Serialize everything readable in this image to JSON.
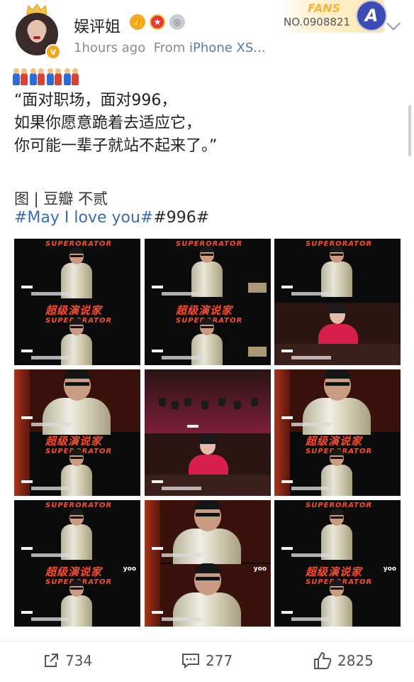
{
  "header": {
    "username": "娱评姐",
    "timestamp": "1hours ago",
    "source_prefix": "From",
    "source_device": "iPhone XS...",
    "fans_card": {
      "label": "FANS",
      "number": "NO.0908821",
      "logo_letter": "A"
    },
    "verified_mark": "V"
  },
  "post": {
    "emoji": [
      "couple-emoji",
      "couple-emoji",
      "couple-emoji",
      "couple-emoji"
    ],
    "text": "“面对职场，面对996，\n如果你愿意跪着去适应它，\n你可能一辈子就站不起来了。”",
    "credit": "图 | 豆瓣 不贰",
    "tag_one": "#May I love you#",
    "tag_two": "#996#"
  },
  "grid": {
    "show_title_cn": "超级演说家",
    "show_title_en": "SUPERORATOR",
    "watermark": "yoo"
  },
  "footer": {
    "repost_count": "734",
    "comment_count": "277",
    "like_count": "2825"
  },
  "colors": {
    "link_blue": "#3d6bb0",
    "tag_title_red": "#ff4a2a",
    "verified_orange": "#f6a417"
  }
}
